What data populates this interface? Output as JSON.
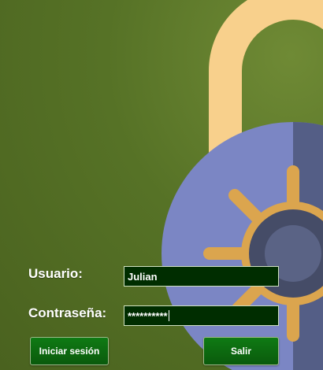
{
  "login": {
    "username_label": "Usuario:",
    "username_value": "Julian",
    "password_label": "Contraseña:",
    "password_value": "**********"
  },
  "buttons": {
    "login_label": "Iniciar sesión",
    "exit_label": "Salir"
  },
  "icons": {
    "background": "padlock-icon"
  },
  "colors": {
    "background_green": "#567226",
    "shackle": "#f8d08c",
    "lock_body": "#7b86c4",
    "lock_body_shadow": "#545e86",
    "dial_ring": "#dba54e",
    "dial_center": "#454c67",
    "field_background": "#002d00",
    "button_green": "#0c6e11"
  }
}
